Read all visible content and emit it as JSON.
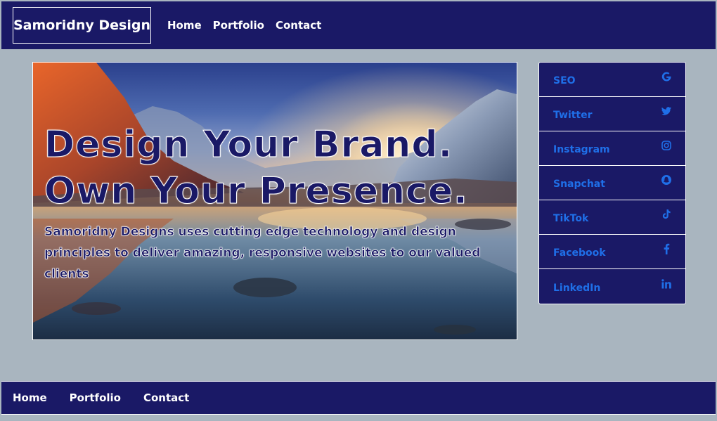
{
  "header": {
    "brand": "Samoridny Design",
    "nav": [
      "Home",
      "Portfolio",
      "Contact"
    ]
  },
  "hero": {
    "title_line1": "Design Your Brand.",
    "title_line2": "Own Your Presence.",
    "text": "Samoridny Designs uses cutting edge technology and design principles to deliver amazing, responsive websites to our valued clients"
  },
  "social": {
    "items": [
      {
        "label": "SEO",
        "icon": "google-icon"
      },
      {
        "label": "Twitter",
        "icon": "twitter-icon"
      },
      {
        "label": "Instagram",
        "icon": "instagram-icon"
      },
      {
        "label": "Snapchat",
        "icon": "snapchat-icon"
      },
      {
        "label": "TikTok",
        "icon": "tiktok-icon"
      },
      {
        "label": "Facebook",
        "icon": "facebook-icon"
      },
      {
        "label": "LinkedIn",
        "icon": "linkedin-icon"
      }
    ]
  },
  "footer": {
    "nav": [
      "Home",
      "Portfolio",
      "Contact"
    ]
  },
  "colors": {
    "navy": "#1a1966",
    "link_blue": "#1f6fe8",
    "background": "#a9b5bf",
    "white": "#ffffff"
  }
}
